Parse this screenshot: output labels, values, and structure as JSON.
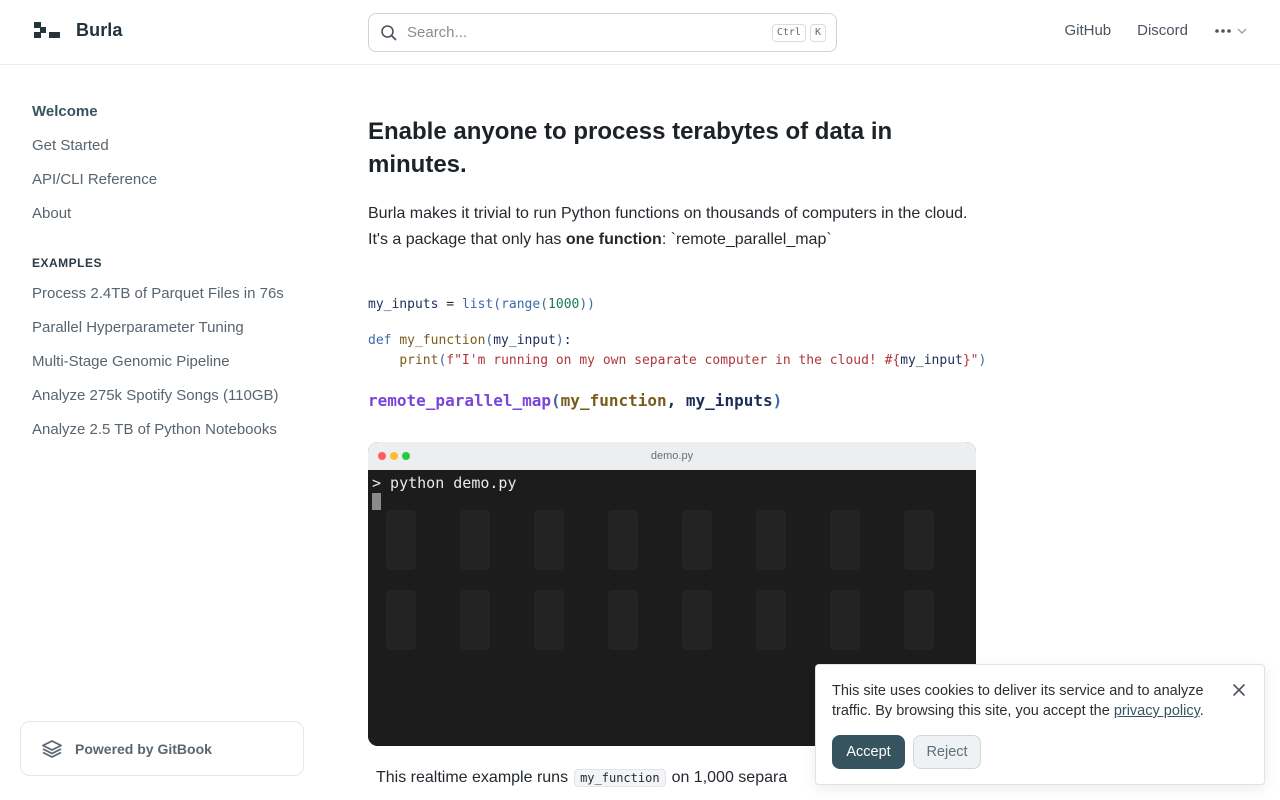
{
  "header": {
    "brand_name": "Burla",
    "search_placeholder": "Search...",
    "kbd_ctrl": "Ctrl",
    "kbd_k": "K",
    "links": {
      "github": "GitHub",
      "discord": "Discord"
    },
    "more_icon": "ellipsis-icon"
  },
  "sidebar": {
    "items": [
      {
        "label": "Welcome",
        "active": true
      },
      {
        "label": "Get Started"
      },
      {
        "label": "API/CLI Reference"
      },
      {
        "label": "About"
      }
    ],
    "section_title": "EXAMPLES",
    "examples": [
      {
        "label": "Process 2.4TB of Parquet Files in 76s"
      },
      {
        "label": "Parallel Hyperparameter Tuning"
      },
      {
        "label": "Multi-Stage Genomic Pipeline"
      },
      {
        "label": "Analyze 275k Spotify Songs (110GB)"
      },
      {
        "label": "Analyze 2.5 TB of Python Notebooks"
      }
    ],
    "powered_by": "Powered by GitBook"
  },
  "main": {
    "title": "Enable anyone to process terabytes of data in minutes.",
    "intro_line1": "Burla makes it trivial to run Python functions on thousands of computers in the cloud.",
    "intro_line2_prefix": "It's a package that only has ",
    "intro_line2_bold": "one function",
    "intro_line2_suffix": ": `remote_parallel_map`",
    "code": {
      "line1_var": "my_inputs",
      "line1_op": " = ",
      "line1_fn1": "list",
      "line1_fn2": "range",
      "line1_num": "1000",
      "line2_kw": "def",
      "line2_name": "my_function",
      "line2_arg": "my_input",
      "line3_fn": "print",
      "line3_str1": "f\"I'm running on my own separate computer in the cloud! #{",
      "line3_var": "my_input",
      "line3_str2": "}\"",
      "line4_fn": "remote_parallel_map",
      "line4_arg1": "my_function",
      "line4_arg2": "my_inputs"
    },
    "terminal": {
      "title": "demo.py",
      "command": "> python demo.py"
    },
    "caption_prefix": "This realtime example runs",
    "caption_code": "my_function",
    "caption_suffix": "on 1,000 separa"
  },
  "cookie": {
    "text": "This site uses cookies to deliver its service and to analyze traffic. By browsing this site, you accept the ",
    "link": "privacy policy",
    "text_end": ".",
    "accept": "Accept",
    "reject": "Reject"
  },
  "colors": {
    "accent": "#36545f",
    "brand": "#23343d",
    "terminal_bg": "#1c1c1c",
    "mac_red": "#ff5f57",
    "mac_yellow": "#febc2e",
    "mac_green": "#28c840"
  }
}
